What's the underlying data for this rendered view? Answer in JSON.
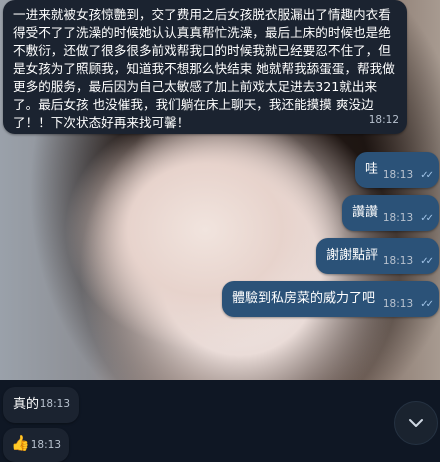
{
  "messages": [
    {
      "text": "一进来就被女孩惊艷到，交了费用之后女孩脱衣服漏出了情趣内衣看得受不了了洗澡的时候她认认真真帮忙洗澡，最后上床的时候也是绝不敷衍，还做了很多很多前戏帮我口的时候我就已经要忍不住了，但是女孩为了照顾我，知道我不想那么快结束 她就帮我舔蛋蛋，帮我做更多的服务，最后因为自己太敏感了加上前戏太足进去321就出来了。最后女孩 也没催我，我们躺在床上聊天，我还能摸摸 爽没边了！！下次状态好再来找可馨！",
      "time": "18:12"
    },
    {
      "text": "哇",
      "time": "18:13"
    },
    {
      "text": "讚讚",
      "time": "18:13"
    },
    {
      "text": "謝謝點評",
      "time": "18:13"
    },
    {
      "text": "體驗到私房菜的威力了吧",
      "time": "18:13"
    },
    {
      "text": "真的",
      "time": "18:13"
    },
    {
      "text": "👍",
      "time": "18:13"
    }
  ],
  "icons": {
    "read_receipt": "double-check-icon",
    "scroll_down": "chevron-down-icon"
  },
  "colors": {
    "incoming_bubble": "#1b2330",
    "outgoing_bubble": "#2b5278",
    "background": "#0e1621"
  }
}
